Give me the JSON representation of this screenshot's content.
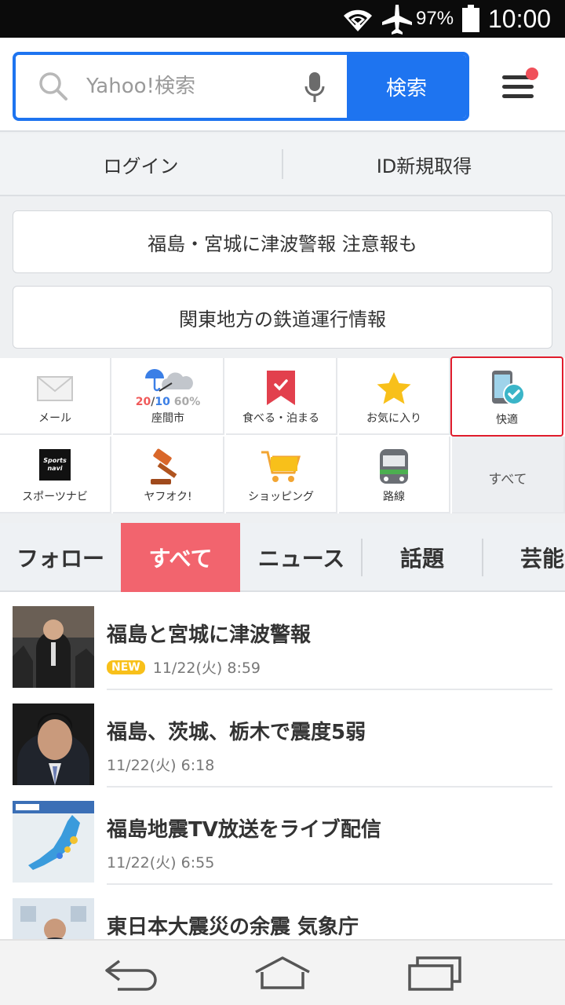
{
  "status_bar": {
    "battery_percent": "97%",
    "time": "10:00",
    "icons": [
      "wifi-icon",
      "airplane-icon",
      "battery-icon"
    ]
  },
  "search": {
    "placeholder": "Yahoo!検索",
    "button_label": "検索"
  },
  "login_bar": {
    "login_label": "ログイン",
    "register_label": "ID新規取得"
  },
  "notices": [
    "福島・宮城に津波警報 注意報も",
    "関東地方の鉄道運行情報"
  ],
  "services": {
    "mail": "メール",
    "weather": {
      "label": "座間市",
      "high": "20",
      "low": "10",
      "rain": "60%"
    },
    "gourmet": "食べる・泊まる",
    "favorites": "お気に入り",
    "comfort": "快適",
    "sports": "スポーツナビ",
    "sports_logo": "Sports navi",
    "auction": "ヤフオク!",
    "shopping": "ショッピング",
    "route": "路線",
    "all": "すべて"
  },
  "tabs": [
    "フォロー",
    "すべて",
    "ニュース",
    "話題",
    "芸能"
  ],
  "active_tab": "すべて",
  "news": [
    {
      "title": "福島と宮城に津波警報",
      "badge": "NEW",
      "time": "11/22(火) 8:59"
    },
    {
      "title": "福島、茨城、栃木で震度5弱",
      "time": "11/22(火) 6:18"
    },
    {
      "title": "福島地震TV放送をライブ配信",
      "time": "11/22(火) 6:55"
    },
    {
      "title": "東日本大震災の余震 気象庁"
    }
  ],
  "colors": {
    "accent_blue": "#1e74f0",
    "active_tab": "#f2646e",
    "highlight_border": "#e01c2c",
    "new_badge": "#f8c01a",
    "notification_dot": "#f0505a"
  }
}
